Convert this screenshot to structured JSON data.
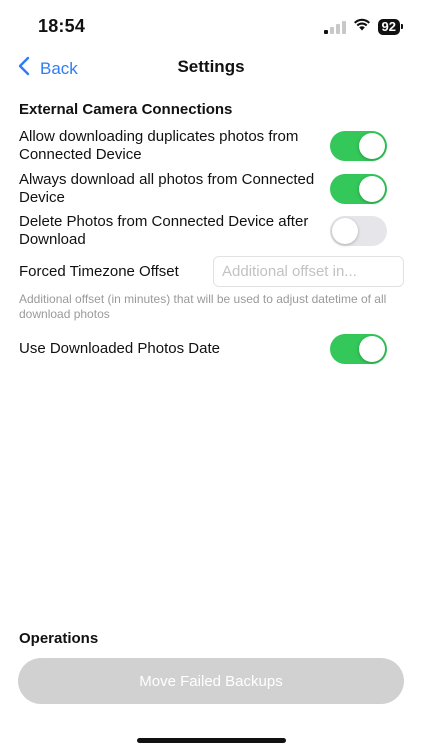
{
  "status_bar": {
    "time": "18:54",
    "battery": "92"
  },
  "nav": {
    "back_label": "Back",
    "title": "Settings"
  },
  "external_camera": {
    "section_title": "External Camera Connections",
    "toggles": [
      {
        "label": "Allow downloading duplicates photos from Connected Device",
        "on": true
      },
      {
        "label": "Always download all photos from Connected Device",
        "on": true
      },
      {
        "label": "Delete Photos from Connected Device after Download",
        "on": false
      }
    ],
    "timezone": {
      "label": "Forced Timezone Offset",
      "placeholder": "Additional offset in...",
      "help": "Additional offset (in minutes) that will be used to adjust datetime of all download photos"
    },
    "use_downloaded_date": {
      "label": "Use Downloaded Photos Date",
      "on": true
    }
  },
  "operations": {
    "section_title": "Operations",
    "move_failed_label": "Move Failed Backups"
  },
  "colors": {
    "accent": "#2f7cf6",
    "toggle_on": "#34c759",
    "toggle_off": "#e5e5ea",
    "disabled_button": "#d1d1d1"
  }
}
